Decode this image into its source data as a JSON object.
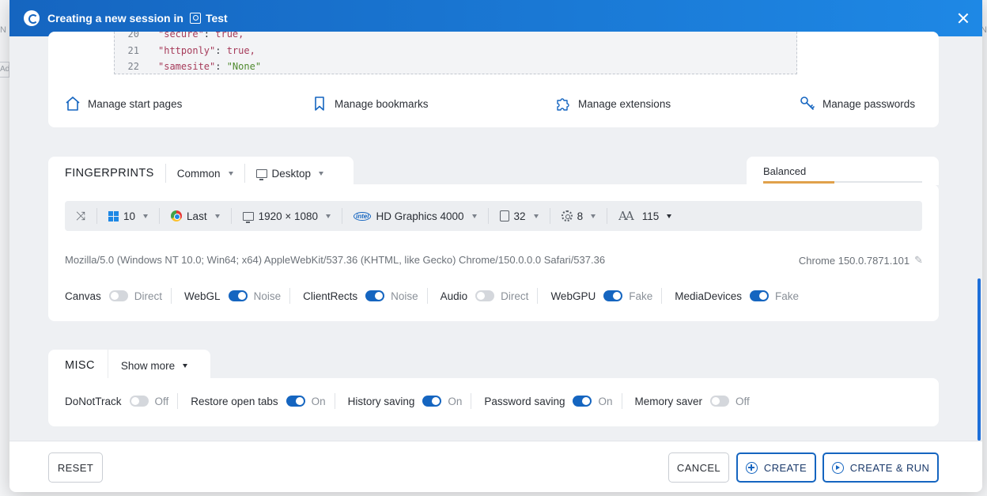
{
  "background": {
    "left_letter": "N",
    "left_box_text": "Ad",
    "right_letter": "N"
  },
  "header": {
    "title": "Creating a new session in",
    "profile_name": "Test"
  },
  "cookies_code": [
    {
      "num": "20",
      "key": "\"secure\"",
      "sep": ": ",
      "value": "true,",
      "type": "kw"
    },
    {
      "num": "21",
      "key": "\"httponly\"",
      "sep": ": ",
      "value": "true,",
      "type": "kw"
    },
    {
      "num": "22",
      "key": "\"samesite\"",
      "sep": ": ",
      "value": "\"None\"",
      "type": "str"
    }
  ],
  "manage_links": {
    "start_pages": "Manage start pages",
    "bookmarks": "Manage bookmarks",
    "extensions": "Manage extensions",
    "passwords": "Manage passwords"
  },
  "fingerprints": {
    "title": "FINGERPRINTS",
    "preset": "Common",
    "platform": "Desktop",
    "mode_label": "Balanced",
    "mode_level": 0.45,
    "os_version": "10",
    "browser_version": "Last",
    "resolution": "1920 × 1080",
    "gpu": "HD Graphics 4000",
    "cpu_threads": "32",
    "memory": "8",
    "fonts_count": "115",
    "user_agent": "Mozilla/5.0 (Windows NT 10.0; Win64; x64) AppleWebKit/537.36 (KHTML, like Gecko) Chrome/150.0.0.0 Safari/537.36",
    "chrome_version": "Chrome 150.0.7871.101",
    "toggles": [
      {
        "label": "Canvas",
        "on": false,
        "state": "Direct"
      },
      {
        "label": "WebGL",
        "on": true,
        "state": "Noise"
      },
      {
        "label": "ClientRects",
        "on": true,
        "state": "Noise"
      },
      {
        "label": "Audio",
        "on": false,
        "state": "Direct"
      },
      {
        "label": "WebGPU",
        "on": true,
        "state": "Fake"
      },
      {
        "label": "MediaDevices",
        "on": true,
        "state": "Fake"
      }
    ]
  },
  "misc": {
    "title": "MISC",
    "show_more": "Show more",
    "toggles": [
      {
        "label": "DoNotTrack",
        "on": false,
        "state": "Off"
      },
      {
        "label": "Restore open tabs",
        "on": true,
        "state": "On"
      },
      {
        "label": "History saving",
        "on": true,
        "state": "On"
      },
      {
        "label": "Password saving",
        "on": true,
        "state": "On"
      },
      {
        "label": "Memory saver",
        "on": false,
        "state": "Off"
      }
    ]
  },
  "footer": {
    "reset": "RESET",
    "cancel": "CANCEL",
    "create": "CREATE",
    "create_run": "CREATE & RUN"
  },
  "colors": {
    "accent": "#1565c0",
    "balanced_bar": "#e0a14b"
  }
}
